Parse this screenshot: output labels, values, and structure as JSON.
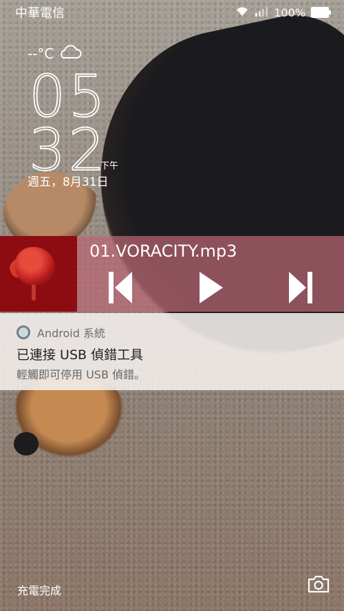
{
  "status_bar": {
    "carrier": "中華電信",
    "battery": "100%"
  },
  "lockscreen": {
    "temperature": "--°C",
    "hour": "05",
    "minute": "32",
    "ampm": "下午",
    "date": "週五，8月31日"
  },
  "media": {
    "track": "01.VORACITY.mp3",
    "icons": [
      "skip-previous-icon",
      "play-icon",
      "skip-next-icon"
    ]
  },
  "notification": {
    "source": "Android 系統",
    "title": "已連接 USB 偵錯工具",
    "text": "輕觸即可停用 USB 偵錯。"
  },
  "bottom": {
    "charging": "充電完成"
  },
  "colors": {
    "media_bg": "#ba6674",
    "album": "#8d0c12"
  }
}
